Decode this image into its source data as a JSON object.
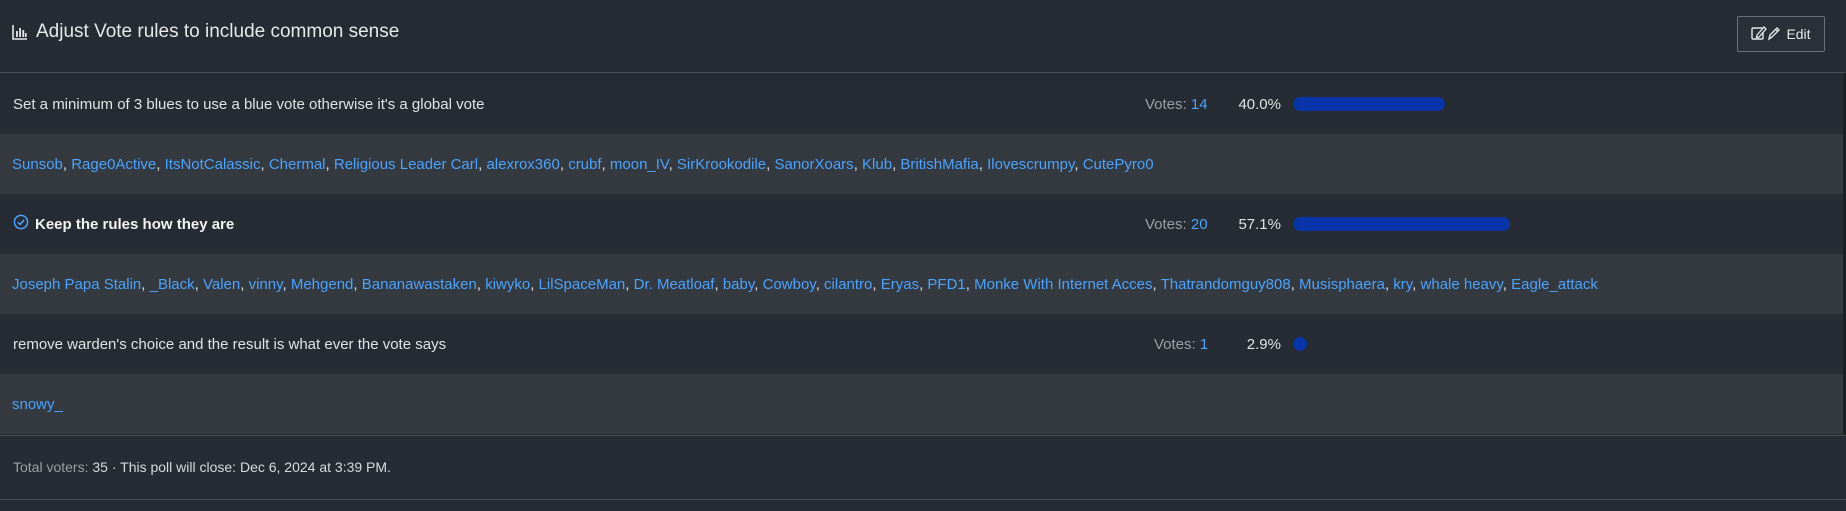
{
  "poll": {
    "title": "Adjust Vote rules to include common sense",
    "title_icon": "bar-chart-icon",
    "edit_label": "Edit",
    "votes_label": "Votes:",
    "options": [
      {
        "text": "Set a minimum of 3 blues to use a blue vote otherwise it's a global vote",
        "votes": "14",
        "percent": "40.0%",
        "fraction": 0.4,
        "selected": false,
        "voters": [
          "Sunsob",
          "Rage0Active",
          "ItsNotCalassic",
          "Chermal",
          "Religious Leader Carl",
          "alexrox360",
          "crubf",
          "moon_IV",
          "SirKrookodile",
          "SanorXoars",
          "Klub",
          "BritishMafia",
          "Ilovescrumpy",
          "CutePyro0"
        ]
      },
      {
        "text": "Keep the rules how they are",
        "votes": "20",
        "percent": "57.1%",
        "fraction": 0.571,
        "selected": true,
        "voters": [
          "Joseph Papa Stalin",
          "_Black",
          "Valen",
          "vinny",
          "Mehgend",
          "Bananawastaken",
          "kiwyko",
          "LilSpaceMan",
          "Dr. Meatloaf",
          "baby",
          "Cowboy",
          "cilantro",
          "Eryas",
          "PFD1",
          "Monke With Internet Acces",
          "Thatrandomguy808",
          "Musisphaera",
          "kry",
          "whale heavy",
          "Eagle_attack"
        ]
      },
      {
        "text": "remove warden's choice and the result is what ever the vote says",
        "votes": "1",
        "percent": "2.9%",
        "fraction": 0.029,
        "selected": false,
        "voters": [
          "snowy_"
        ]
      }
    ],
    "footer": {
      "total_label": "Total voters:",
      "total_value": "35",
      "close_text": "· This poll will close: Dec 6, 2024 at 3:39 PM."
    },
    "colors": {
      "bar": "#0a35a8",
      "link": "#4aa3ff",
      "background": "#272b33",
      "voters_background": "#353a40"
    }
  }
}
